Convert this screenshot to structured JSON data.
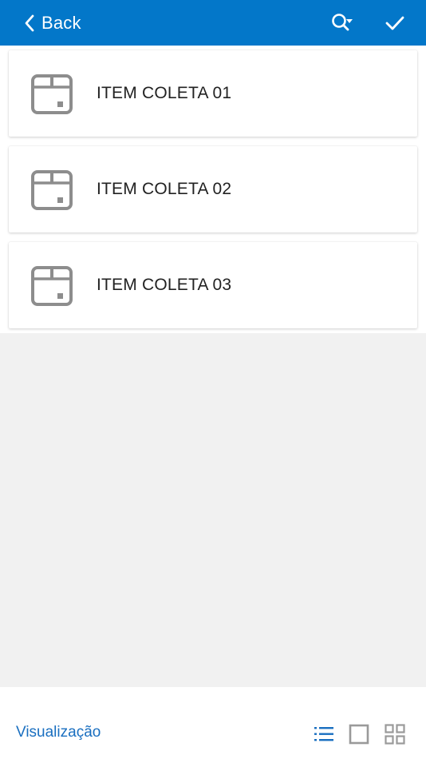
{
  "header": {
    "back_label": "Back",
    "bg_color": "#0377c9"
  },
  "items": [
    {
      "label": "ITEM COLETA 01",
      "icon": "package-icon"
    },
    {
      "label": "ITEM COLETA 02",
      "icon": "package-icon"
    },
    {
      "label": "ITEM COLETA 03",
      "icon": "package-icon"
    }
  ],
  "footer": {
    "view_label": "Visualização",
    "view_options": [
      {
        "name": "list-view-icon",
        "active": true
      },
      {
        "name": "single-card-view-icon",
        "active": false
      },
      {
        "name": "grid-view-icon",
        "active": false
      }
    ],
    "accent_color": "#1a6fc0",
    "inactive_color": "#9a9a9a"
  }
}
